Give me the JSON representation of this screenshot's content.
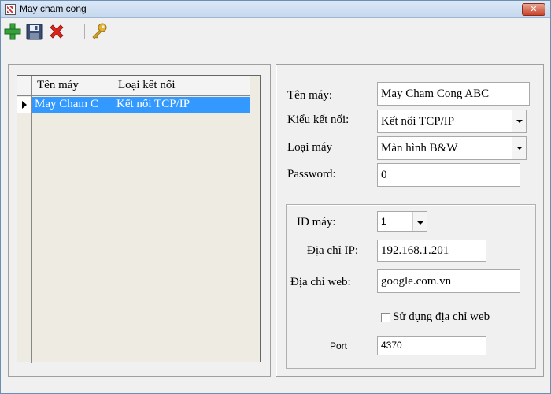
{
  "window": {
    "title": "May cham cong",
    "close_symbol": "✕"
  },
  "toolbar": {
    "icons": [
      "add-icon",
      "save-icon",
      "delete-icon",
      "key-icon"
    ]
  },
  "grid": {
    "columns": [
      "Tên máy",
      "Loại kêt nối"
    ],
    "rows": [
      {
        "name": "May Cham C",
        "connection": "Kết nối TCP/IP",
        "selected": true
      }
    ]
  },
  "form": {
    "name_label": "Tên máy:",
    "name_value": "May Cham Cong ABC",
    "conn_type_label": "Kiểu kết nối:",
    "conn_type_value": "Kết nối TCP/IP",
    "machine_type_label": "Loại máy",
    "machine_type_value": "Màn hình B&W",
    "password_label": "Password:",
    "password_value": "0"
  },
  "connection_group": {
    "id_label": "ID máy:",
    "id_value": "1",
    "ip_label": "Địa chỉ IP:",
    "ip_value": "192.168.1.201",
    "web_label": "Địa chỉ web:",
    "web_value": "google.com.vn",
    "use_web_label": "Sử dụng địa chỉ web",
    "use_web_checked": false,
    "port_label": "Port",
    "port_value": "4370"
  },
  "colors": {
    "selection": "#3399ff",
    "grid_bg": "#eeebe3",
    "window_bg": "#f0f0f0"
  }
}
